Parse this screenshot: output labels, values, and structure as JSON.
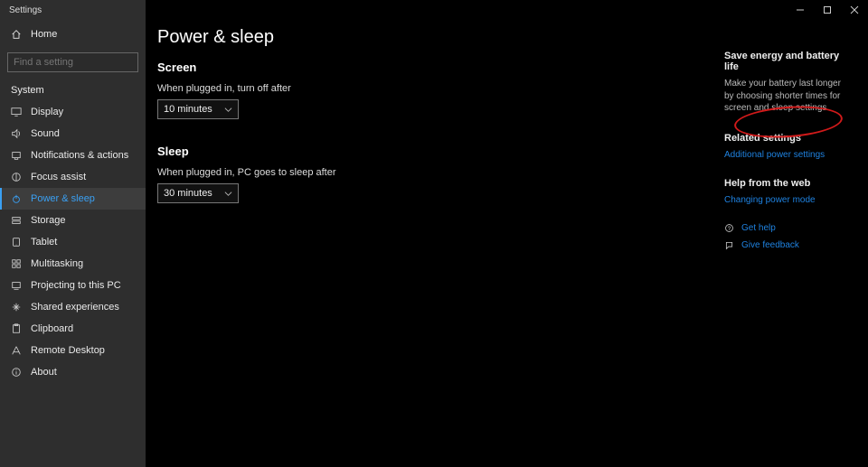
{
  "window": {
    "title": "Settings"
  },
  "sidebar": {
    "home_label": "Home",
    "search_placeholder": "Find a setting",
    "group_label": "System",
    "items": [
      {
        "icon": "display-icon",
        "label": "Display"
      },
      {
        "icon": "sound-icon",
        "label": "Sound"
      },
      {
        "icon": "notifications-icon",
        "label": "Notifications & actions"
      },
      {
        "icon": "focus-icon",
        "label": "Focus assist"
      },
      {
        "icon": "power-icon",
        "label": "Power & sleep"
      },
      {
        "icon": "storage-icon",
        "label": "Storage"
      },
      {
        "icon": "tablet-icon",
        "label": "Tablet"
      },
      {
        "icon": "multitask-icon",
        "label": "Multitasking"
      },
      {
        "icon": "project-icon",
        "label": "Projecting to this PC"
      },
      {
        "icon": "shared-icon",
        "label": "Shared experiences"
      },
      {
        "icon": "clipboard-icon",
        "label": "Clipboard"
      },
      {
        "icon": "remote-icon",
        "label": "Remote Desktop"
      },
      {
        "icon": "about-icon",
        "label": "About"
      }
    ]
  },
  "page": {
    "title": "Power & sleep",
    "sections": {
      "screen": {
        "heading": "Screen",
        "label": "When plugged in, turn off after",
        "value": "10 minutes"
      },
      "sleep": {
        "heading": "Sleep",
        "label": "When plugged in, PC goes to sleep after",
        "value": "30 minutes"
      }
    }
  },
  "aside": {
    "tip_heading": "Save energy and battery life",
    "tip_body": "Make your battery last longer by choosing shorter times for screen and sleep settings.",
    "related_heading": "Related settings",
    "related_link": "Additional power settings",
    "webhelp_heading": "Help from the web",
    "webhelp_link": "Changing power mode",
    "gethelp": "Get help",
    "feedback": "Give feedback"
  }
}
